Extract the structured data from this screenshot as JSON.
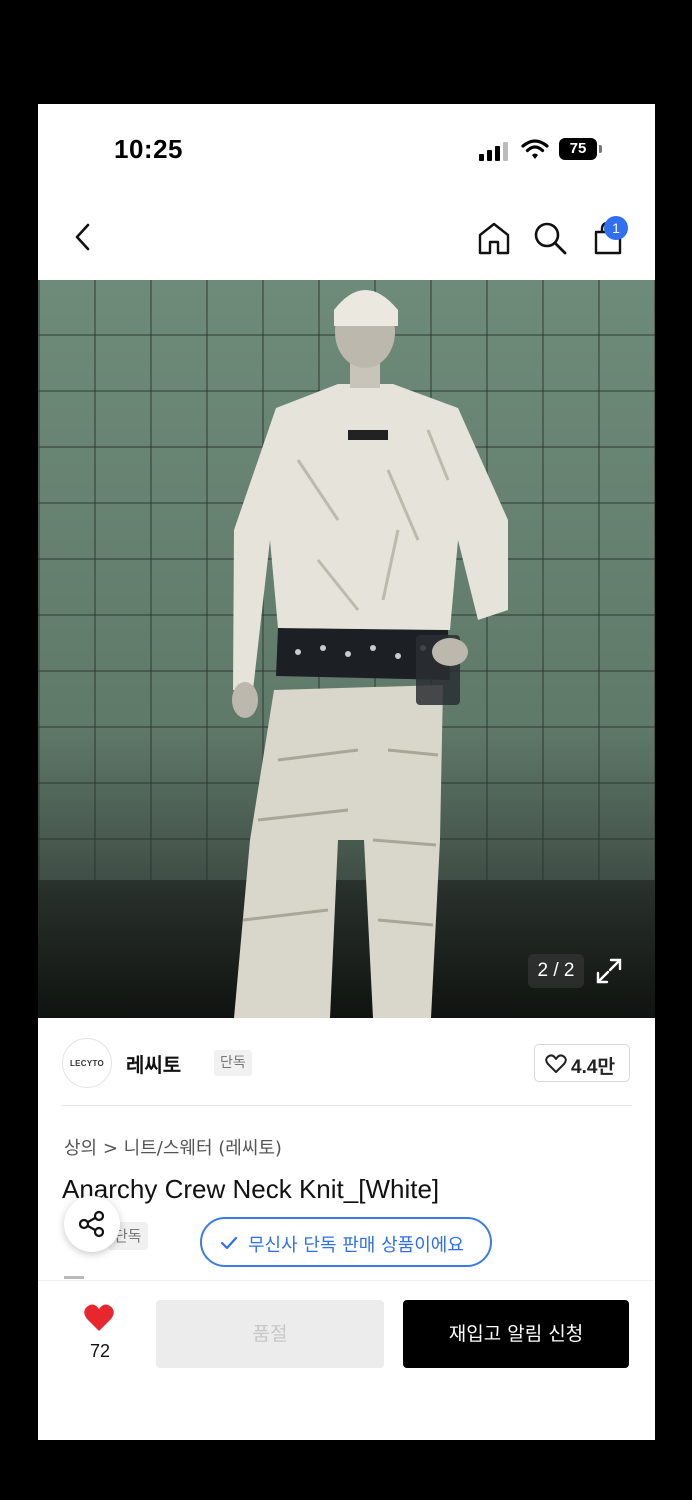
{
  "status_bar": {
    "time": "10:25",
    "battery": "75"
  },
  "nav": {
    "cart_count": "1"
  },
  "photo": {
    "counter": "2 / 2"
  },
  "brand": {
    "logo_text": "LECYTO",
    "name": "레씨토",
    "tag": "단독",
    "likes": "4.4만"
  },
  "product": {
    "category": "상의 > 니트/스웨터 (레씨토)",
    "title": "Anarchy Crew Neck Knit_[White]",
    "exclusive_tag": "단독",
    "exclusive_notice": "무신사 단독 판매 상품이에요"
  },
  "bottom_bar": {
    "wish_count": "72",
    "soldout_label": "품절",
    "restock_label": "재입고 알림 신청"
  },
  "colors": {
    "accent_blue": "#2f6ff0",
    "heart_red": "#e8262d",
    "primary_button": "#000000"
  },
  "icons": [
    "back-icon",
    "home-icon",
    "search-icon",
    "cart-icon",
    "expand-icon",
    "heart-outline-icon",
    "share-icon",
    "check-icon",
    "heart-filled-icon"
  ]
}
